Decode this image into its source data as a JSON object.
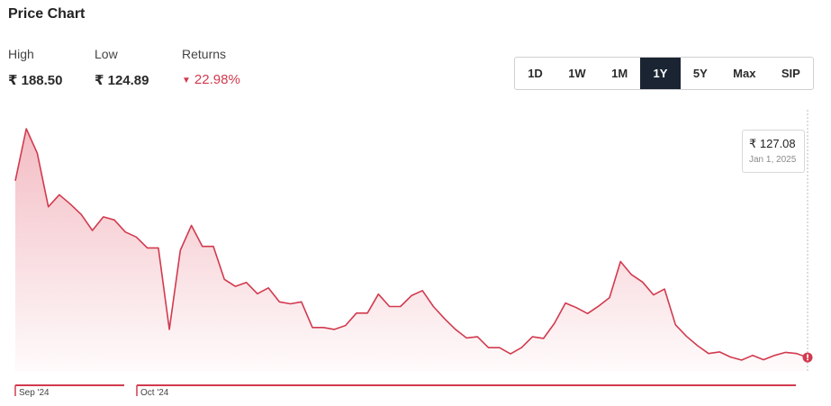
{
  "title": "Price Chart",
  "stats": {
    "high_label": "High",
    "high_value": "₹ 188.50",
    "low_label": "Low",
    "low_value": "₹ 124.89",
    "returns_label": "Returns",
    "returns_value": "22.98%",
    "returns_direction": "down",
    "returns_color": "#d23a4e"
  },
  "range_tabs": [
    "1D",
    "1W",
    "1M",
    "1Y",
    "5Y",
    "Max",
    "SIP"
  ],
  "active_range": "1Y",
  "tooltip": {
    "price": "₹ 127.08",
    "date": "Jan 1, 2025"
  },
  "chart_data": {
    "type": "area",
    "color": "#d23a4e",
    "x_ticks": [
      "Sep '24",
      "Oct '24"
    ],
    "values": [
      172.6,
      186.0,
      179.7,
      165.9,
      169.0,
      166.6,
      163.9,
      159.8,
      163.3,
      162.5,
      159.4,
      158.1,
      155.3,
      155.3,
      134.3,
      154.7,
      161.1,
      155.7,
      155.7,
      147.2,
      145.4,
      146.4,
      143.5,
      145.0,
      141.4,
      140.9,
      141.4,
      134.8,
      134.8,
      134.3,
      135.3,
      138.5,
      138.5,
      143.4,
      140.2,
      140.2,
      143.0,
      144.3,
      140.2,
      137.1,
      134.3,
      132.1,
      132.4,
      129.6,
      129.6,
      128.0,
      129.6,
      132.4,
      132.0,
      135.9,
      141.1,
      139.9,
      138.4,
      140.3,
      142.5,
      151.8,
      148.4,
      146.5,
      143.2,
      144.7,
      135.5,
      132.5,
      130.1,
      128.1,
      128.5,
      127.2,
      126.4,
      127.6,
      126.5,
      127.6,
      128.4,
      128.1,
      127.08
    ]
  }
}
